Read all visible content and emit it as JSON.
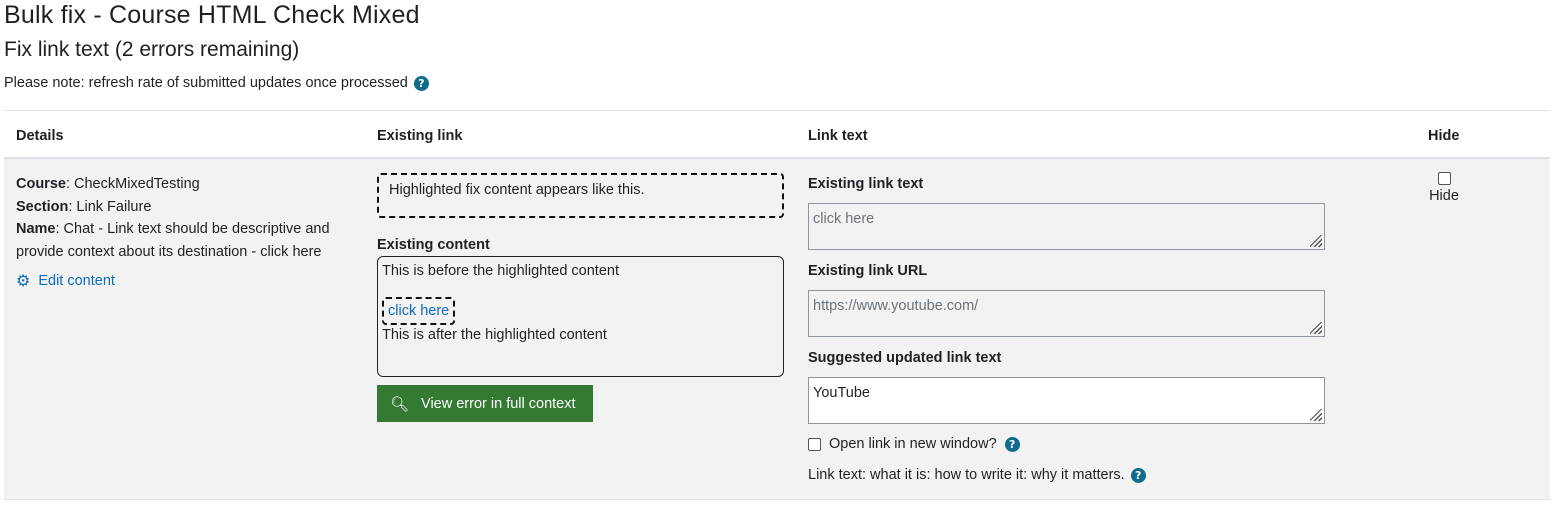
{
  "page": {
    "title": "Bulk fix - Course HTML Check Mixed",
    "subtitle": "Fix link text (2 errors remaining)",
    "note": "Please note: refresh rate of submitted updates once processed"
  },
  "table": {
    "headers": {
      "details": "Details",
      "existing_link": "Existing link",
      "link_text": "Link text",
      "hide": "Hide"
    }
  },
  "row": {
    "course_label": "Course",
    "course_value": ": CheckMixedTesting",
    "section_label": "Section",
    "section_value": ": Link Failure",
    "name_label": "Name",
    "name_value": ": Chat - Link text should be descriptive and provide context about its destination - click here",
    "edit_content": "Edit content",
    "highlight_sample": "Highlighted fix content appears like this.",
    "existing_content_label": "Existing content",
    "content_before": "This is before the highlighted content",
    "content_link": "click here",
    "content_after": "This is after the highlighted content",
    "view_error_button": "View error in full context",
    "existing_link_text_label": "Existing link text",
    "existing_link_text_value": "click here",
    "existing_link_url_label": "Existing link URL",
    "existing_link_url_value": "https://www.youtube.com/",
    "suggested_label": "Suggested updated link text",
    "suggested_value": "YouTube",
    "open_new_window": "Open link in new window?",
    "link_text_info": "Link text: what it is: how to write it: why it matters.",
    "hide_label": "Hide"
  },
  "icons": {
    "help": "help-icon",
    "gear": "gear-icon",
    "zoom": "magnify-plus-icon"
  },
  "colors": {
    "primary_link": "#0f6cbf",
    "success_button": "#357a32",
    "help_icon": "#0f6c8c",
    "row_background": "#f2f2f2"
  }
}
